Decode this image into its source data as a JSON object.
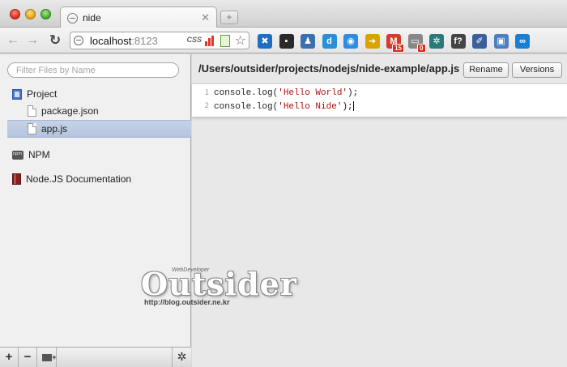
{
  "browser": {
    "tab_title": "nide",
    "tab_close": "✕",
    "newtab": "+",
    "url_host": "localhost",
    "url_port": ":8123",
    "css_badge": "CSS",
    "extensions": [
      {
        "name": "puzzle-ext-icon",
        "glyph": "✖",
        "color": "#1e6fc4"
      },
      {
        "name": "delicious-ext-icon",
        "glyph": "▪",
        "color": "#2a2a2a"
      },
      {
        "name": "people-ext-icon",
        "glyph": "♟",
        "color": "#3b6fb0"
      },
      {
        "name": "d-ext-icon",
        "glyph": "d",
        "color": "#2b8fd8"
      },
      {
        "name": "search-ext-icon",
        "glyph": "◉",
        "color": "#2d8de0"
      },
      {
        "name": "arrow-phone-ext-icon",
        "glyph": "➜",
        "color": "#d9a400"
      },
      {
        "name": "gmail-ext-icon",
        "glyph": "M",
        "color": "#d63b2b",
        "badge": "15"
      },
      {
        "name": "reader-ext-icon",
        "glyph": "▭",
        "color": "#888888",
        "badge": "0"
      },
      {
        "name": "globe-ext-icon",
        "glyph": "✲",
        "color": "#2a7a7a"
      },
      {
        "name": "fquestion-ext-icon",
        "glyph": "f?",
        "color": "#444444"
      },
      {
        "name": "eyedropper-ext-icon",
        "glyph": "✐",
        "color": "#3a5f9a"
      },
      {
        "name": "screenshot-ext-icon",
        "glyph": "▣",
        "color": "#4c7fc0"
      },
      {
        "name": "infinity-ext-icon",
        "glyph": "∞",
        "color": "#1a7fd0"
      }
    ]
  },
  "sidebar": {
    "filter_placeholder": "Filter Files by Name",
    "project_label": "Project",
    "files": [
      "package.json",
      "app.js"
    ],
    "npm_label": "NPM",
    "docs_label": "Node.JS Documentation",
    "footer": {
      "add": "+",
      "remove": "−",
      "gear": "✲"
    }
  },
  "watermark": {
    "top": "WebDeveloper",
    "main": "Outsider",
    "url": "http://blog.outsider.ne.kr"
  },
  "main": {
    "path": "/Users/outsider/projects/nodejs/nide-example/app.js",
    "rename_label": "Rename",
    "versions_label": "Versions",
    "lines": [
      {
        "num": "1",
        "prefix": "console.log(",
        "string": "'Hello World'",
        "suffix": ");"
      },
      {
        "num": "2",
        "prefix": "console.log(",
        "string": "'Hello Nide'",
        "suffix": ");"
      }
    ]
  }
}
